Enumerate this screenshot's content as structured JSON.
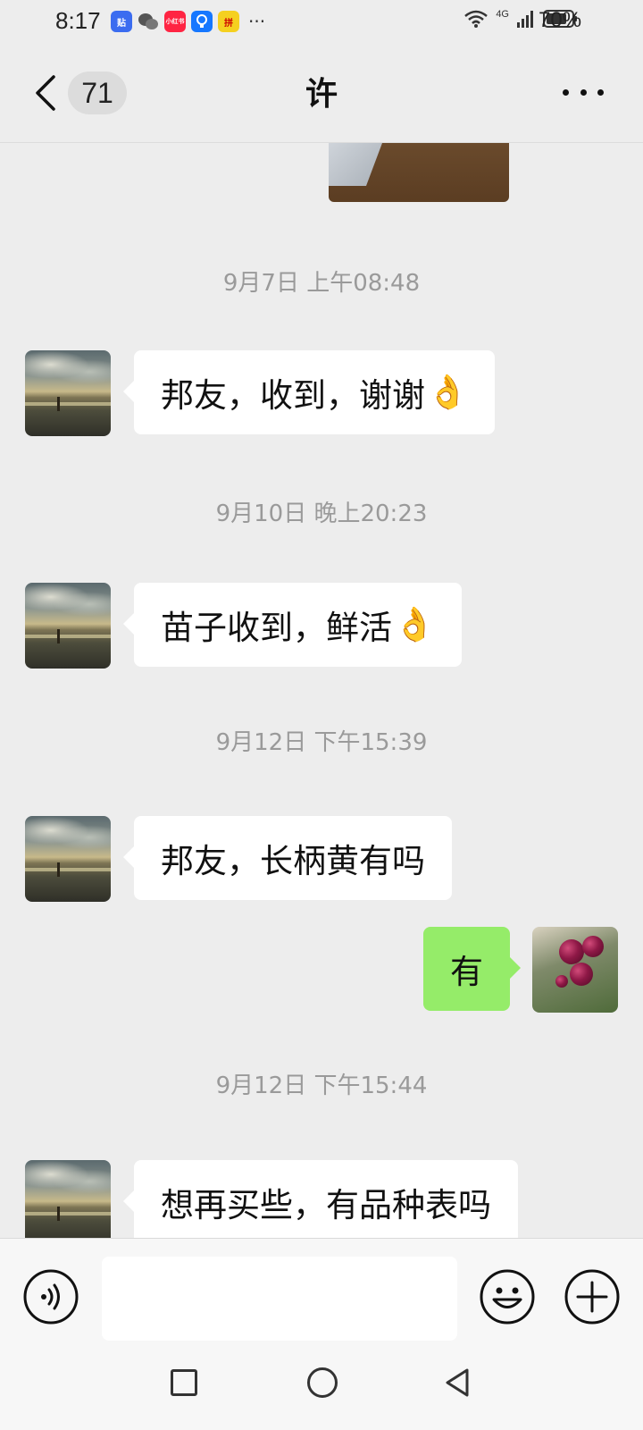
{
  "status_bar": {
    "time": "8:17",
    "app_icons": [
      {
        "name": "tieba-icon",
        "label": "贴",
        "color": "#3b6cf0"
      },
      {
        "name": "wechat-icon",
        "label": "",
        "color": "#555555"
      },
      {
        "name": "xiaohongshu-icon",
        "label": "小红书",
        "color": "#ff2442"
      },
      {
        "name": "bulb-app-icon",
        "label": "",
        "color": "#1677ff"
      },
      {
        "name": "pinduoduo-icon",
        "label": "拼",
        "color": "#f5d020"
      }
    ],
    "more": "···",
    "network": "4G",
    "battery": "70%"
  },
  "header": {
    "unread_count": "71",
    "title": "许"
  },
  "messages": [
    {
      "type": "time",
      "text": "9月7日 上午08:48"
    },
    {
      "type": "text",
      "from": "other",
      "text": "邦友，收到，谢谢",
      "emoji": "👌"
    },
    {
      "type": "time",
      "text": "9月10日 晚上20:23"
    },
    {
      "type": "text",
      "from": "other",
      "text": "苗子收到，鲜活",
      "emoji": "👌"
    },
    {
      "type": "time",
      "text": "9月12日 下午15:39"
    },
    {
      "type": "text",
      "from": "other",
      "text": "邦友，长柄黄有吗",
      "emoji": ""
    },
    {
      "type": "text",
      "from": "me",
      "text": "有",
      "emoji": ""
    },
    {
      "type": "time",
      "text": "9月12日 下午15:44"
    },
    {
      "type": "text",
      "from": "other",
      "text": "想再买些，有品种表吗",
      "emoji": ""
    }
  ],
  "input": {
    "value": "",
    "placeholder": ""
  },
  "colors": {
    "background": "#ededed",
    "my_bubble": "#95ec69",
    "other_bubble": "#ffffff",
    "timestamp": "#9a9a9a"
  }
}
